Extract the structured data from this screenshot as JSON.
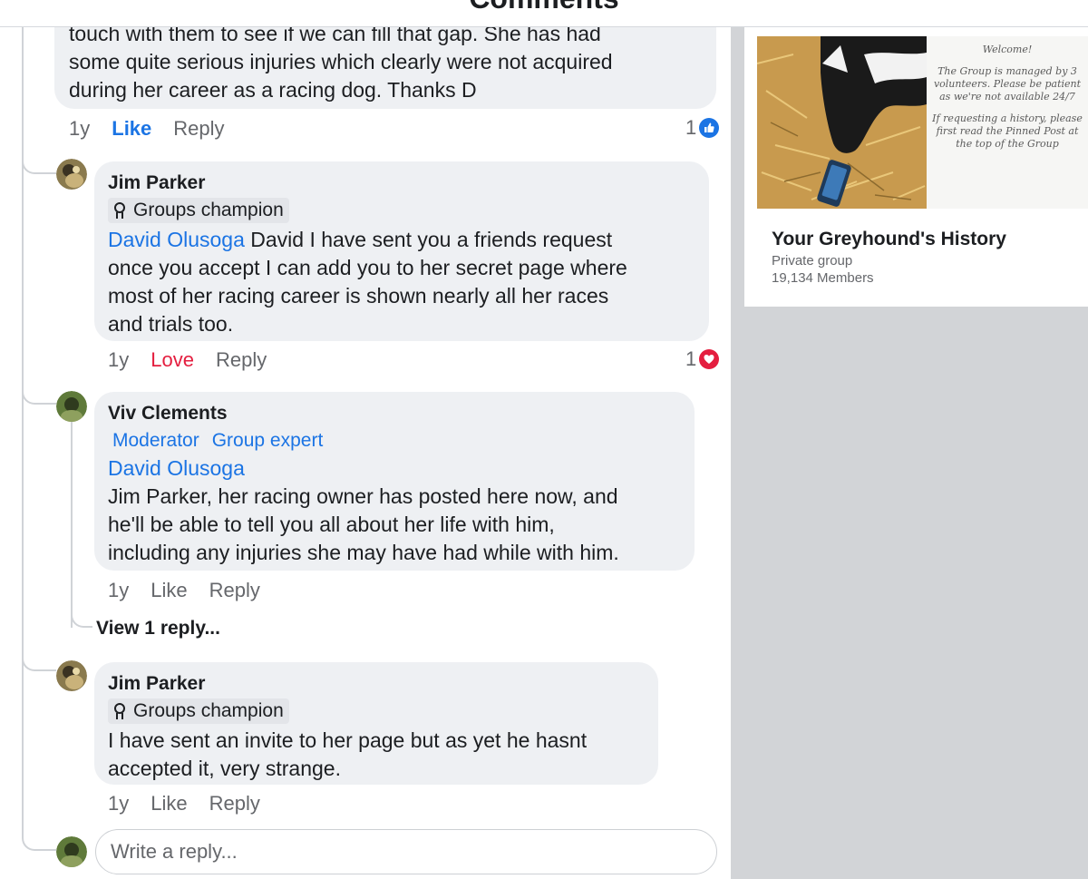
{
  "header": {
    "title": "Comments"
  },
  "comment_top": {
    "text_lines": [
      "touch with them to see if we can fill that gap. She has had",
      "some quite serious injuries which clearly were not acquired",
      "during her career as a racing dog. Thanks D"
    ],
    "time": "1y",
    "like_label": "Like",
    "reply_label": "Reply",
    "reaction_count": "1",
    "reaction_type": "like"
  },
  "comment_jim_1": {
    "author": "Jim Parker",
    "badge": "Groups champion",
    "mention": "David Olusoga",
    "text_lines": [
      " David I have sent you a friends request",
      "once you accept I can add you to her secret page where",
      "most of her racing career is shown nearly all her races",
      "and trials too."
    ],
    "time": "1y",
    "love_label": "Love",
    "reply_label": "Reply",
    "reaction_count": "1",
    "reaction_type": "love"
  },
  "comment_viv": {
    "author": "Viv Clements",
    "roles": [
      "Moderator",
      "Group expert"
    ],
    "mention": "David Olusoga",
    "text_lines": [
      "Jim Parker, her racing owner has posted here now, and",
      "he'll be able to tell you all about her life with him,",
      "including any injuries she may have had while with him."
    ],
    "time": "1y",
    "like_label": "Like",
    "reply_label": "Reply",
    "view_replies": "View 1 reply..."
  },
  "comment_jim_2": {
    "author": "Jim Parker",
    "badge": "Groups champion",
    "text_lines": [
      "I have sent an invite to her page but as yet he hasnt",
      "accepted it, very strange."
    ],
    "time": "1y",
    "like_label": "Like",
    "reply_label": "Reply"
  },
  "reply_box": {
    "placeholder": "Write a reply..."
  },
  "group": {
    "name": "Your Greyhound's History",
    "type": "Private group",
    "members": "19,134 Members",
    "welcome_lines": [
      "Welcome!",
      "The Group is managed by 3 volunteers. Please be patient as we're not available 24/7",
      "If requesting a history, please first read the Pinned Post at the top of the Group"
    ]
  },
  "colors": {
    "accent": "#1b74e4",
    "love": "#e41e3f",
    "bubble": "#eef0f3",
    "panel": "#d2d4d7"
  }
}
